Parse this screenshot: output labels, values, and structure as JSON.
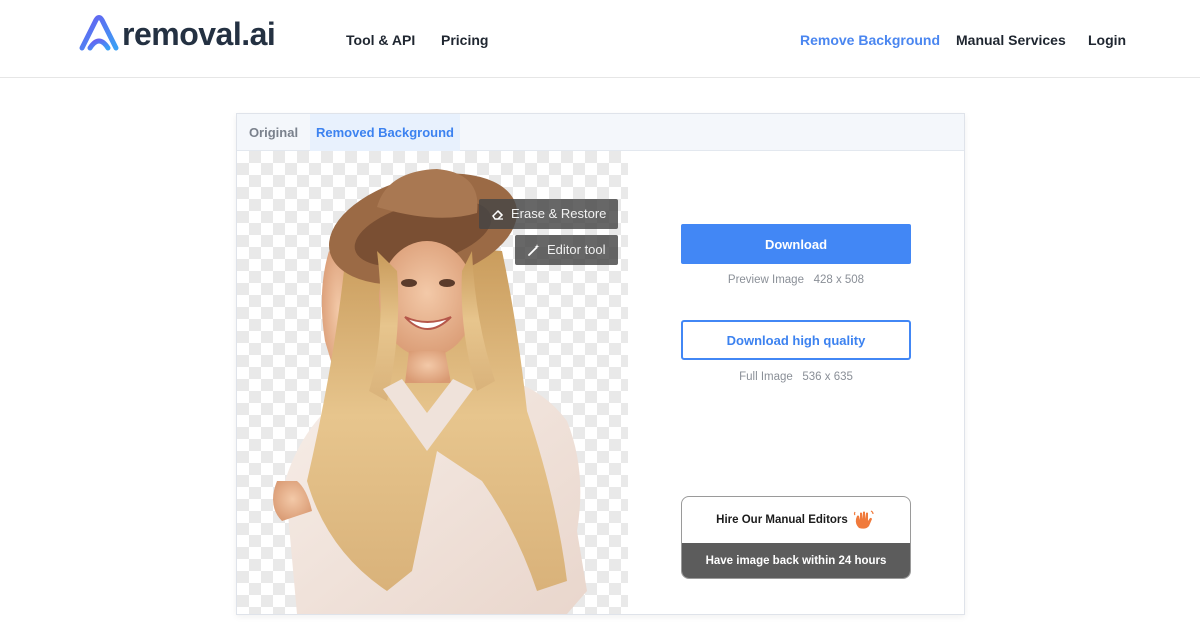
{
  "header": {
    "logo_text": "removal.ai",
    "nav_left": [
      {
        "label": "Tool & API"
      },
      {
        "label": "Pricing"
      }
    ],
    "nav_right": [
      {
        "label": "Remove Background",
        "active": true
      },
      {
        "label": "Manual Services"
      },
      {
        "label": "Login"
      }
    ]
  },
  "panel": {
    "tabs": [
      {
        "label": "Original",
        "active": false
      },
      {
        "label": "Removed Background",
        "active": true
      }
    ],
    "tools": {
      "erase_restore": "Erase & Restore",
      "editor_tool": "Editor tool"
    },
    "download": {
      "label": "Download",
      "preview_label": "Preview Image",
      "preview_size": "428 x 508"
    },
    "download_hq": {
      "label": "Download high quality",
      "full_label": "Full Image",
      "full_size": "536 x 635"
    },
    "manual": {
      "title": "Hire Our Manual Editors",
      "subtitle": "Have image back within 24 hours",
      "icon": "waving-hand-icon"
    }
  },
  "colors": {
    "accent": "#4287f5",
    "nav_active": "#4a86f0",
    "logo_text": "#243142",
    "card_dark": "#5c5c5c"
  }
}
